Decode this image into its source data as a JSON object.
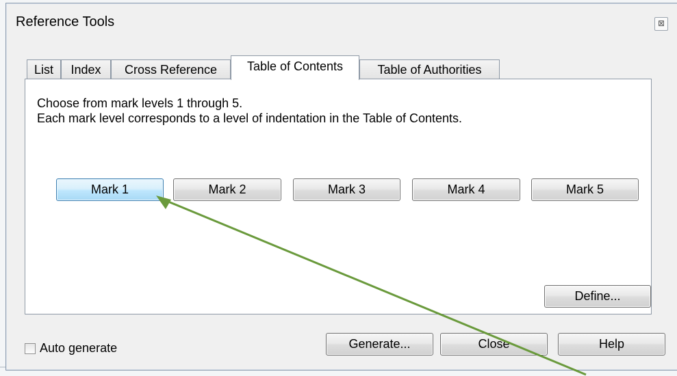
{
  "window": {
    "title": "Reference Tools",
    "close_glyph": "⊠"
  },
  "tabs": [
    {
      "label": "List",
      "active": false
    },
    {
      "label": "Index",
      "active": false
    },
    {
      "label": "Cross Reference",
      "active": false
    },
    {
      "label": "Table of Contents",
      "active": true
    },
    {
      "label": "Table of Authorities",
      "active": false
    }
  ],
  "panel": {
    "line1": "Choose from mark levels 1 through 5.",
    "line2": "Each mark level corresponds to a level of indentation in the Table of Contents.",
    "marks": [
      "Mark 1",
      "Mark 2",
      "Mark 3",
      "Mark 4",
      "Mark 5"
    ],
    "define_label": "Define..."
  },
  "footer": {
    "auto_generate_label": "Auto generate",
    "auto_generate_checked": false,
    "generate_label": "Generate...",
    "close_label": "Close",
    "help_label": "Help"
  },
  "annotation": {
    "arrow_color": "#6a9a3c",
    "points_to": "Mark 1"
  }
}
